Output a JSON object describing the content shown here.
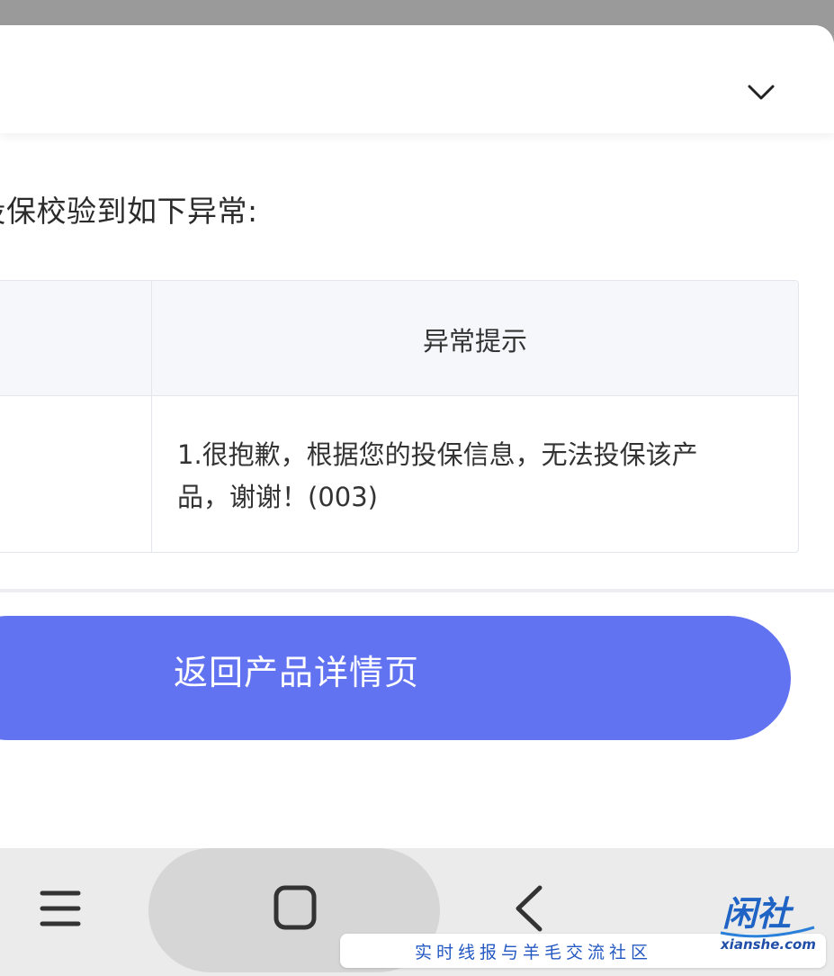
{
  "dialog": {
    "intro_text": "次投保校验到如下异常:",
    "table": {
      "header_col2": "异常提示",
      "row1_col2": "1.很抱歉，根据您的投保信息，无法投保该产品，谢谢！(003)"
    },
    "primary_button_label": "返回产品详情页"
  },
  "navbar": {
    "icons": [
      "menu-icon",
      "home-icon",
      "back-icon"
    ]
  },
  "watermark": {
    "logo_text": "闲社",
    "domain_text": "xianshe.com",
    "tagline": "实时线报与羊毛交流社区"
  },
  "colors": {
    "accent": "#6273f2",
    "watermark_blue": "#2358c2"
  }
}
